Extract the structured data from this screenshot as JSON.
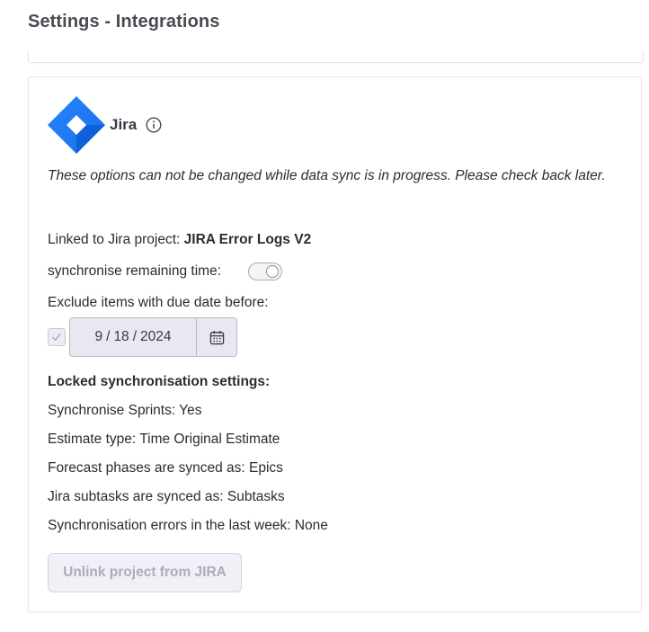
{
  "page": {
    "title": "Settings - Integrations"
  },
  "jira": {
    "name": "Jira",
    "notice": "These options can not be changed while data sync is in progress. Please check back later.",
    "linked_label": "Linked to Jira project: ",
    "linked_project": "JIRA Error Logs V2",
    "sync_remaining_label": "synchronise remaining time:",
    "sync_remaining_enabled": false,
    "exclude_label": "Exclude items with due date before:",
    "exclude_checked": true,
    "date": {
      "month": "9",
      "day": "18",
      "year": "2024",
      "separator": "/"
    },
    "locked_heading": "Locked synchronisation settings:",
    "locked_settings": [
      "Synchronise Sprints: Yes",
      "Estimate type: Time Original Estimate",
      "Forecast phases are synced as: Epics",
      "Jira subtasks are synced as: Subtasks",
      "Synchronisation errors in the last week: None"
    ],
    "unlink_button": "Unlink project from JIRA"
  },
  "colors": {
    "jira_blue_light": "#2684ff",
    "jira_blue_dark": "#0052cc",
    "disabled_text": "#adacb9"
  },
  "icons": {
    "logo": "jira-logo",
    "info": "info-icon",
    "toggle": "toggle-switch",
    "checkbox": "checkmark-icon",
    "calendar": "calendar-icon"
  }
}
